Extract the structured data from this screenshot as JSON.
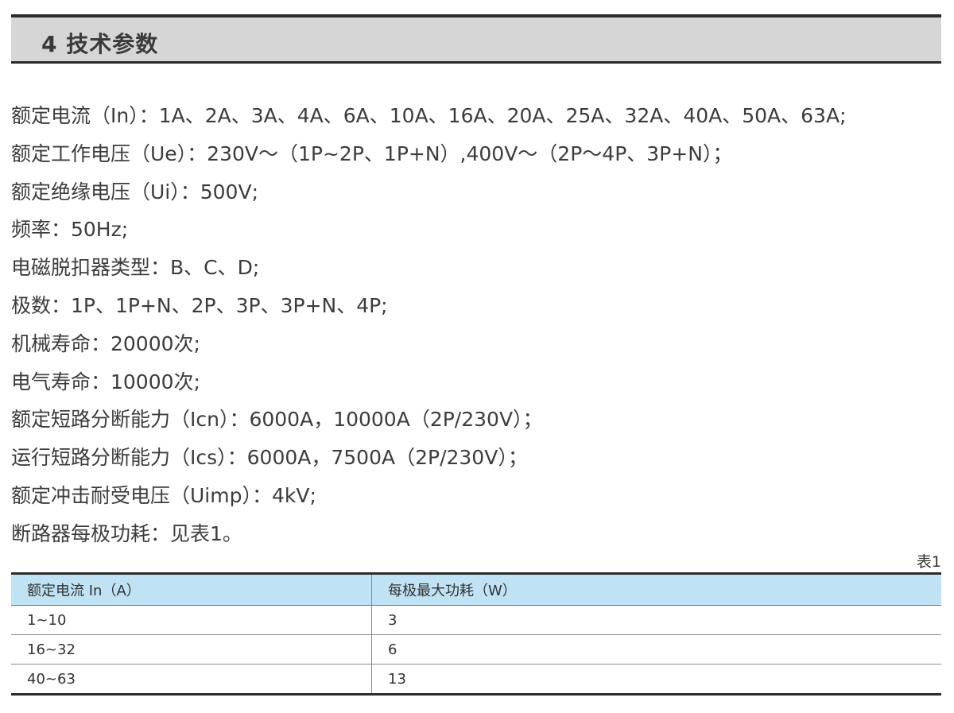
{
  "section": {
    "title": "4 技术参数"
  },
  "params": [
    "额定电流（In）：1A、2A、3A、4A、6A、10A、16A、20A、25A、32A、40A、50A、63A;",
    "额定工作电压（Ue）：230V～（1P~2P、1P+N）,400V～（2P～4P、3P+N）；",
    "额定绝缘电压（Ui）：500V;",
    "频率：50Hz;",
    "电磁脱扣器类型：B、C、D;",
    "极数：1P、1P+N、2P、3P、3P+N、4P;",
    "机械寿命：20000次;",
    "电气寿命：10000次;",
    "额定短路分断能力（Icn）：6000A，10000A（2P/230V）；",
    "运行短路分断能力（Ics）：6000A，7500A（2P/230V）；",
    "额定冲击耐受电压（Uimp）：4kV;",
    "断路器每极功耗：见表1。"
  ],
  "table": {
    "caption": "表1",
    "headers": [
      "额定电流 In（A）",
      "每极最大功耗（W）"
    ],
    "rows": [
      [
        "1~10",
        "3"
      ],
      [
        "16~32",
        "6"
      ],
      [
        "40~63",
        "13"
      ]
    ]
  },
  "colors": {
    "header_bar": "#d6d6d6",
    "table_header": "#bfe3f4",
    "rule": "#2b2b2b"
  }
}
